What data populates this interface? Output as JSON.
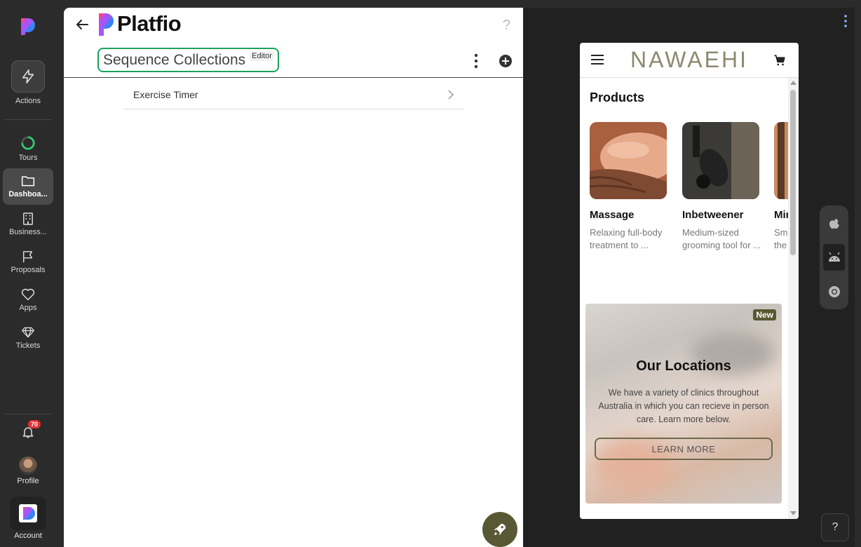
{
  "sidebar": {
    "actions_label": "Actions",
    "items": [
      {
        "label": "Tours",
        "icon": "progress-ring-icon"
      },
      {
        "label": "Dashboa...",
        "icon": "folder-icon",
        "active": true
      },
      {
        "label": "Business...",
        "icon": "building-icon"
      },
      {
        "label": "Proposals",
        "icon": "flag-icon"
      },
      {
        "label": "Apps",
        "icon": "heart-icon"
      },
      {
        "label": "Tickets",
        "icon": "diamond-icon"
      }
    ],
    "notifications_count": "70",
    "profile_label": "Profile",
    "account_label": "Account"
  },
  "editor": {
    "brand": "Platfio",
    "help": "?",
    "title": "Sequence Collections",
    "title_tag": "Editor",
    "list": [
      {
        "label": "Exercise Timer"
      }
    ]
  },
  "preview": {
    "brand": "NAWAEHI",
    "products_title": "Products",
    "products": [
      {
        "name": "Massage",
        "desc1": "Relaxing full-body",
        "desc2": "treatment to ..."
      },
      {
        "name": "Inbetweener",
        "desc1": "Medium-sized",
        "desc2": "grooming tool for ..."
      },
      {
        "name": "Mir",
        "desc1": "Sm",
        "desc2": "the"
      }
    ],
    "locations": {
      "badge": "New",
      "title": "Our Locations",
      "text": "We have a variety of clinics throughout Australia in which you can recieve in person care. Learn more below.",
      "button": "LEARN MORE"
    },
    "help": "?"
  },
  "colors": {
    "accent_green": "#1aa35a",
    "olive": "#585834",
    "brand_text": "#8c8a6e",
    "notification_red": "#e03131"
  }
}
